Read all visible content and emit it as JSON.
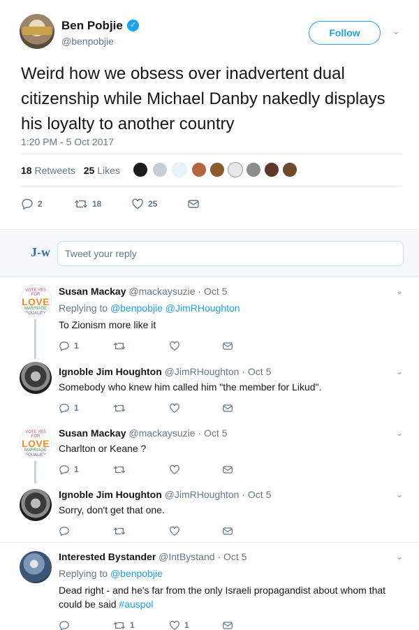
{
  "tweet": {
    "author_name": "Ben Pobjie",
    "author_handle": "@benpobjie",
    "follow_label": "Follow",
    "text": "Weird how we obsess over inadvertent dual citizenship while Michael Danby nakedly displays his loyalty to another country",
    "timestamp": "1:20 PM - 5 Oct 2017",
    "retweets_count": "18",
    "retweets_label": "Retweets",
    "likes_count": "25",
    "likes_label": "Likes",
    "replies": "2",
    "retweets": "18",
    "likes": "25"
  },
  "reply_box": {
    "avatar_text": "J-w",
    "placeholder": "Tweet your reply"
  },
  "replies": [
    {
      "name": "Susan Mackay",
      "meta": "@mackaysuzie · Oct 5",
      "replying_prefix": "Replying to",
      "replying_to": "@benpobjie @JimRHoughton",
      "text": "To Zionism more like it",
      "reply_count": "1",
      "avatar": {
        "l1": "VOTE YES FOR",
        "l2": "LOVE",
        "l3": "MARRIAGE",
        "l4": "EQUALITY"
      }
    },
    {
      "name": "Ignoble Jim Houghton",
      "meta": "@JimRHoughton · Oct 5",
      "text": "Somebody who knew him called him \"the member for Likud\".",
      "reply_count": "1"
    },
    {
      "name": "Susan Mackay",
      "meta": "@mackaysuzie · Oct 5",
      "text": "Charlton or Keane ?",
      "reply_count": "1",
      "avatar": {
        "l1": "VOTE YES FOR",
        "l2": "LOVE",
        "l3": "MARRIAGE",
        "l4": "EQUALITY"
      }
    },
    {
      "name": "Ignoble Jim Houghton",
      "meta": "@JimRHoughton · Oct 5",
      "text": "Sorry, don't get that one."
    },
    {
      "name": "Interested Bystander",
      "meta": "@IntBystand · Oct 5",
      "replying_prefix": "Replying to",
      "replying_to": "@benpobjie",
      "text_line1": "Dead right - and he's far from the only Israeli propagandist about whom that",
      "text_line2_prefix": "could be said",
      "hashtag": "#auspol",
      "retweet_count": "1",
      "like_count": "1"
    }
  ],
  "colors": {
    "twitter_blue": "#1da1f2",
    "secondary_text": "#657786",
    "border": "#e6ecf0"
  }
}
